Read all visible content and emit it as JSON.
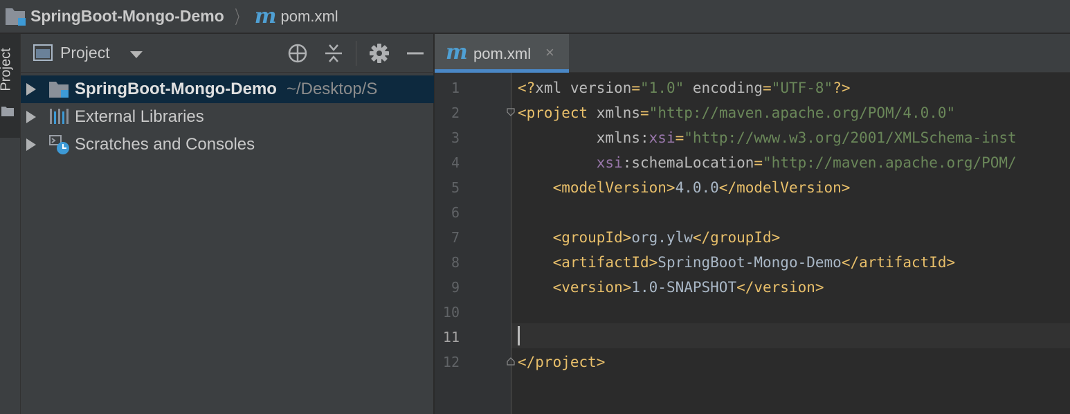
{
  "breadcrumb": {
    "project": "SpringBoot-Mongo-Demo",
    "file": "pom.xml",
    "file_icon_letter": "m"
  },
  "tool_strip": {
    "project_tab_label": "Project"
  },
  "project_panel": {
    "view_label": "Project",
    "tree": [
      {
        "label": "SpringBoot-Mongo-Demo",
        "path": "~/Desktop/S",
        "icon": "project-folder-icon",
        "selected": true
      },
      {
        "label": "External Libraries",
        "icon": "libraries-icon",
        "selected": false
      },
      {
        "label": "Scratches and Consoles",
        "icon": "scratches-icon",
        "selected": false
      }
    ]
  },
  "editor": {
    "tab_label": "pom.xml",
    "tab_close": "×",
    "current_line": 11,
    "line_numbers": [
      "1",
      "2",
      "3",
      "4",
      "5",
      "6",
      "7",
      "8",
      "9",
      "10",
      "11",
      "12"
    ],
    "lines": [
      [
        {
          "t": "tag",
          "v": "<?"
        },
        {
          "t": "attr",
          "v": "xml version"
        },
        {
          "t": "tag",
          "v": "="
        },
        {
          "t": "val",
          "v": "\"1.0\""
        },
        {
          "t": "attr",
          "v": " encoding"
        },
        {
          "t": "tag",
          "v": "="
        },
        {
          "t": "val",
          "v": "\"UTF-8\""
        },
        {
          "t": "tag",
          "v": "?>"
        }
      ],
      [
        {
          "t": "tag",
          "v": "<project "
        },
        {
          "t": "attr",
          "v": "xmlns"
        },
        {
          "t": "tag",
          "v": "="
        },
        {
          "t": "val",
          "v": "\"http://maven.apache.org/POM/4.0.0\""
        }
      ],
      [
        {
          "t": "attr",
          "v": "         xmlns:"
        },
        {
          "t": "ns",
          "v": "xsi"
        },
        {
          "t": "tag",
          "v": "="
        },
        {
          "t": "val",
          "v": "\"http://www.w3.org/2001/XMLSchema-inst"
        }
      ],
      [
        {
          "t": "ns",
          "v": "         xsi"
        },
        {
          "t": "attr",
          "v": ":schemaLocation"
        },
        {
          "t": "tag",
          "v": "="
        },
        {
          "t": "val",
          "v": "\"http://maven.apache.org/POM/"
        }
      ],
      [
        {
          "t": "tag",
          "v": "    <modelVersion>"
        },
        {
          "t": "text",
          "v": "4.0.0"
        },
        {
          "t": "tag",
          "v": "</modelVersion>"
        }
      ],
      [],
      [
        {
          "t": "tag",
          "v": "    <groupId>"
        },
        {
          "t": "text",
          "v": "org.ylw"
        },
        {
          "t": "tag",
          "v": "</groupId>"
        }
      ],
      [
        {
          "t": "tag",
          "v": "    <artifactId>"
        },
        {
          "t": "text",
          "v": "SpringBoot-Mongo-Demo"
        },
        {
          "t": "tag",
          "v": "</artifactId>"
        }
      ],
      [
        {
          "t": "tag",
          "v": "    <version>"
        },
        {
          "t": "text",
          "v": "1.0-SNAPSHOT"
        },
        {
          "t": "tag",
          "v": "</version>"
        }
      ],
      [],
      [],
      [
        {
          "t": "tag",
          "v": "</project>"
        }
      ]
    ]
  },
  "colors": {
    "tag": "#e8bf6a",
    "string": "#6a8759",
    "namespace": "#9876aa",
    "selection": "#0d293e",
    "accent": "#4a88c7"
  }
}
